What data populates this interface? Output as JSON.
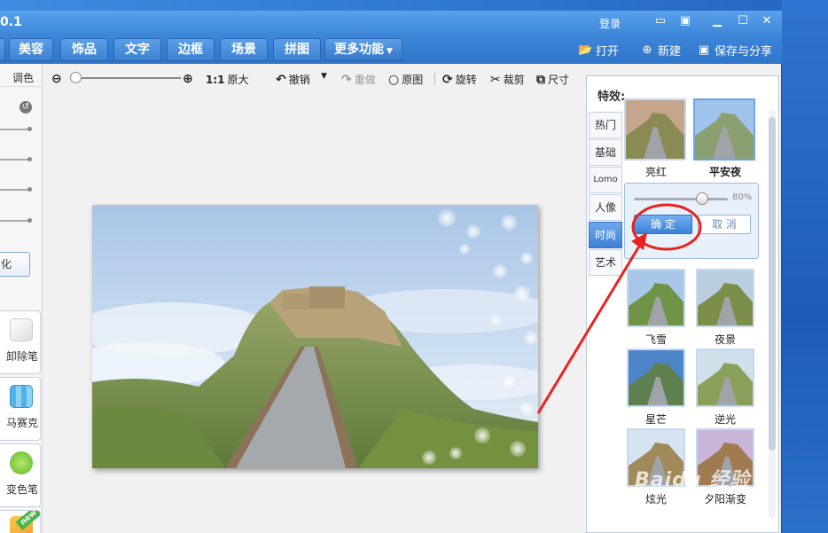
{
  "titlebar": {
    "title": "0.1",
    "login": "登录",
    "icons": [
      "chat-icon",
      "menu-icon",
      "minimize-icon",
      "maximize-icon",
      "close-icon"
    ]
  },
  "tabs": [
    {
      "label": "美容"
    },
    {
      "label": "饰品"
    },
    {
      "label": "文字"
    },
    {
      "label": "边框"
    },
    {
      "label": "场景"
    },
    {
      "label": "拼图"
    },
    {
      "label": "更多功能"
    }
  ],
  "top_actions": {
    "open": "打开",
    "new": "新建",
    "save_share": "保存与分享"
  },
  "left_panel": {
    "heading": "调色",
    "button_label": "化",
    "tools": [
      {
        "label": "卸除笔",
        "icon": "eraser-icon"
      },
      {
        "label": "马赛克",
        "icon": "mosaic-icon"
      },
      {
        "label": "变色笔",
        "icon": "color-pen-icon"
      },
      {
        "label": "new",
        "icon": "new-tool-icon"
      }
    ]
  },
  "canvas_toolbar": {
    "original_size": "1:1",
    "original_size_label": "原大",
    "undo": "撤销",
    "redo": "重做",
    "original": "原图",
    "rotate": "旋转",
    "crop": "裁剪",
    "size": "尺寸",
    "zoom_level": 0.0
  },
  "effects_panel": {
    "title": "特效:",
    "categories": [
      "热门",
      "基础",
      "Lomo",
      "人像",
      "时尚",
      "艺术"
    ],
    "active_category": "时尚",
    "top_thumbs": [
      {
        "label": "亮红"
      },
      {
        "label": "平安夜",
        "selected": true
      }
    ],
    "grid_thumbs": [
      {
        "label": "飞雪"
      },
      {
        "label": "夜景"
      },
      {
        "label": "星芒"
      },
      {
        "label": "逆光"
      },
      {
        "label": "炫光"
      },
      {
        "label": "夕阳渐变"
      }
    ],
    "popup": {
      "intensity_pct": "80%",
      "intensity": 0.8,
      "confirm": "确 定",
      "cancel": "取 消"
    }
  },
  "watermark": "Baidu 经验",
  "colors": {
    "titlebar": "#4a94e2",
    "tab_active": "#3d82d2",
    "annotation": "#e8231f"
  }
}
